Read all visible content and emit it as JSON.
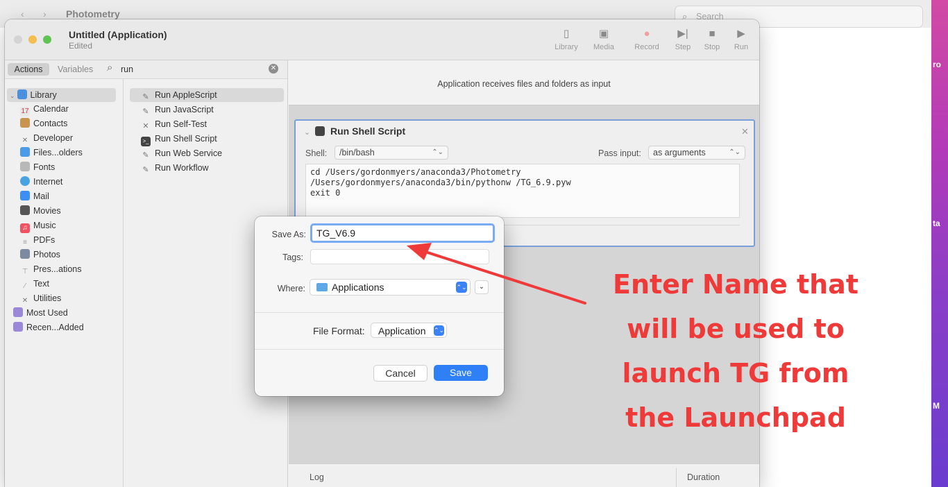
{
  "background": {
    "finder_title": "Photometry",
    "search_placeholder": "Search",
    "strip_letters": [
      "ro",
      "ta",
      "M"
    ]
  },
  "window": {
    "title": "Untitled (Application)",
    "subtitle": "Edited",
    "toolbar": [
      {
        "label": "Library",
        "icon": "sidebar-icon"
      },
      {
        "label": "Media",
        "icon": "photo-icon"
      },
      {
        "label": "Record",
        "icon": "record-icon"
      },
      {
        "label": "Step",
        "icon": "step-icon"
      },
      {
        "label": "Stop",
        "icon": "stop-icon"
      },
      {
        "label": "Run",
        "icon": "play-icon"
      }
    ]
  },
  "library": {
    "tabs": {
      "actions": "Actions",
      "variables": "Variables"
    },
    "search_value": "run",
    "items": [
      {
        "label": "Library",
        "color": "#4a8fe0"
      },
      {
        "label": "Calendar",
        "color": "#e8e8e8"
      },
      {
        "label": "Contacts",
        "color": "#c8954f"
      },
      {
        "label": "Developer",
        "color": "#8a8a8a"
      },
      {
        "label": "Files...olders",
        "color": "#4b9be8"
      },
      {
        "label": "Fonts",
        "color": "#b8b8b8"
      },
      {
        "label": "Internet",
        "color": "#4aa3e0"
      },
      {
        "label": "Mail",
        "color": "#3d8ef5"
      },
      {
        "label": "Movies",
        "color": "#555555"
      },
      {
        "label": "Music",
        "color": "#f05262"
      },
      {
        "label": "PDFs",
        "color": "#d0d0d0"
      },
      {
        "label": "Photos",
        "color": "#7d8aa0"
      },
      {
        "label": "Pres...ations",
        "color": "#d4d4d4"
      },
      {
        "label": "Text",
        "color": "#cfcfcf"
      },
      {
        "label": "Utilities",
        "color": "#8a8a8a"
      },
      {
        "label": "Most Used",
        "color": "#9b88d8"
      },
      {
        "label": "Recen...Added",
        "color": "#9b88d8"
      }
    ]
  },
  "actions": [
    "Run AppleScript",
    "Run JavaScript",
    "Run Self-Test",
    "Run Shell Script",
    "Run Web Service",
    "Run Workflow"
  ],
  "workflow": {
    "header": "Application receives files and folders as input",
    "card": {
      "title": "Run Shell Script",
      "shell_label": "Shell:",
      "shell_value": "/bin/bash",
      "pass_label": "Pass input:",
      "pass_value": "as arguments",
      "script_lines": [
        "cd /Users/gordonmyers/anaconda3/Photometry",
        "/Users/gordonmyers/anaconda3/bin/pythonw /TG_6.9.pyw",
        "exit 0"
      ]
    },
    "log_label": "Log",
    "duration_label": "Duration"
  },
  "save_sheet": {
    "save_as_label": "Save As:",
    "save_as_value": "TG_V6.9",
    "tags_label": "Tags:",
    "where_label": "Where:",
    "where_value": "Applications",
    "format_label": "File Format:",
    "format_value": "Application",
    "cancel_label": "Cancel",
    "save_label": "Save"
  },
  "annotation": {
    "lines": [
      "Enter Name that",
      "will be used to",
      "launch TG from",
      "the Launchpad"
    ],
    "color": "#ef3a3a"
  }
}
